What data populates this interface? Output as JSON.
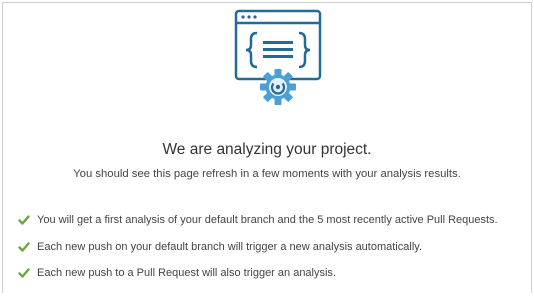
{
  "illustration": {
    "icon": "code-window-with-gear-icon",
    "colors": {
      "outline": "#236a97",
      "gear": "#4b9fd5",
      "gear_light": "#e6f2fa"
    }
  },
  "heading": {
    "title": "We are analyzing your project.",
    "subtitle": "You should see this page refresh in a few moments with your analysis results."
  },
  "checklist": {
    "check_color": "#6aa842",
    "items": [
      {
        "text": "You will get a first analysis of your default branch and the 5 most recently active Pull Requests."
      },
      {
        "text": "Each new push on your default branch will trigger a new analysis automatically."
      },
      {
        "text": "Each new push to a Pull Request will also trigger an analysis."
      }
    ]
  }
}
